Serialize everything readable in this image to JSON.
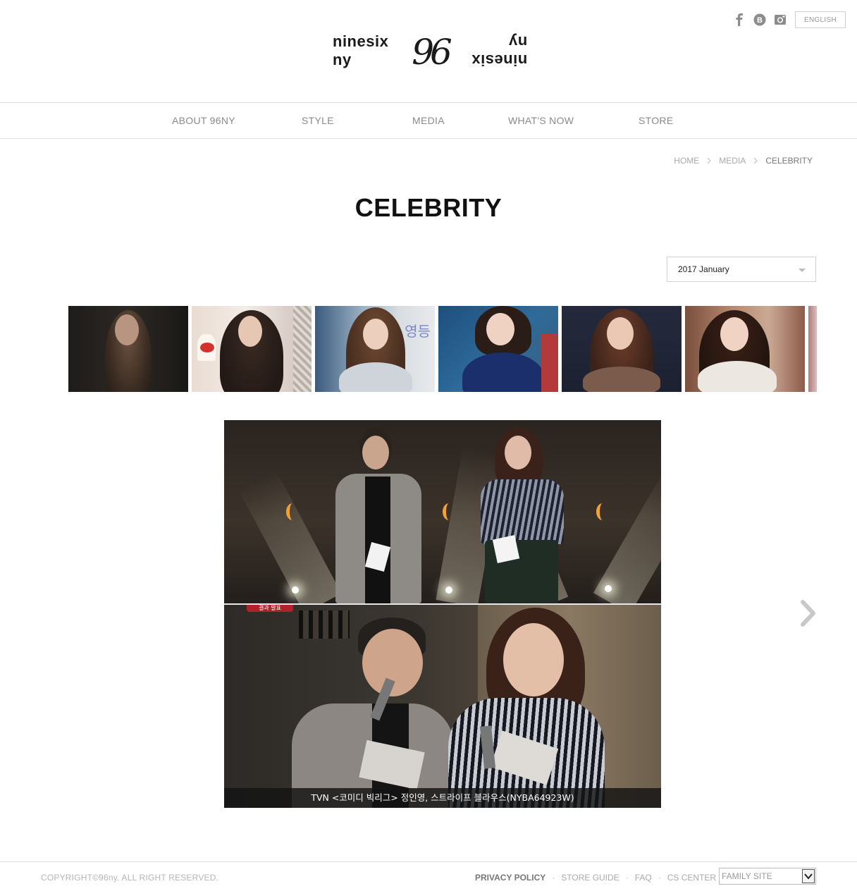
{
  "header": {
    "logo": {
      "left_word": "ninesix ny",
      "number": "96",
      "right_word": "ninesix ny"
    },
    "social": [
      {
        "name": "facebook-icon",
        "glyph": "f"
      },
      {
        "name": "blog-icon",
        "glyph": "B"
      },
      {
        "name": "instagram-icon",
        "glyph": ""
      }
    ],
    "language_button": "ENGLISH"
  },
  "nav": {
    "items": [
      {
        "label": "ABOUT 96NY"
      },
      {
        "label": "STYLE"
      },
      {
        "label": "MEDIA"
      },
      {
        "label": "WHAT'S NOW"
      },
      {
        "label": "STORE"
      }
    ]
  },
  "breadcrumb": {
    "items": [
      "HOME",
      "MEDIA",
      "CELEBRITY"
    ]
  },
  "page": {
    "title": "CELEBRITY",
    "month_select": {
      "value": "2017 January"
    }
  },
  "gallery": {
    "main_caption": "TVN <코미디 빅리그> 정인영, 스트라이프 블라우스(NYBA64923W)",
    "result_tag": "결과 발표"
  },
  "footer": {
    "copyright": "COPYRIGHT©96ny. ALL RIGHT RESERVED.",
    "links": [
      "PRIVACY POLICY",
      "STORE GUIDE",
      "FAQ",
      "CS CENTER"
    ],
    "family_site": "FAMILY SITE"
  },
  "colors": {
    "nav_text": "#8a8a8a",
    "border": "#dedede",
    "title": "#111111",
    "caption_bg": "#141414"
  }
}
